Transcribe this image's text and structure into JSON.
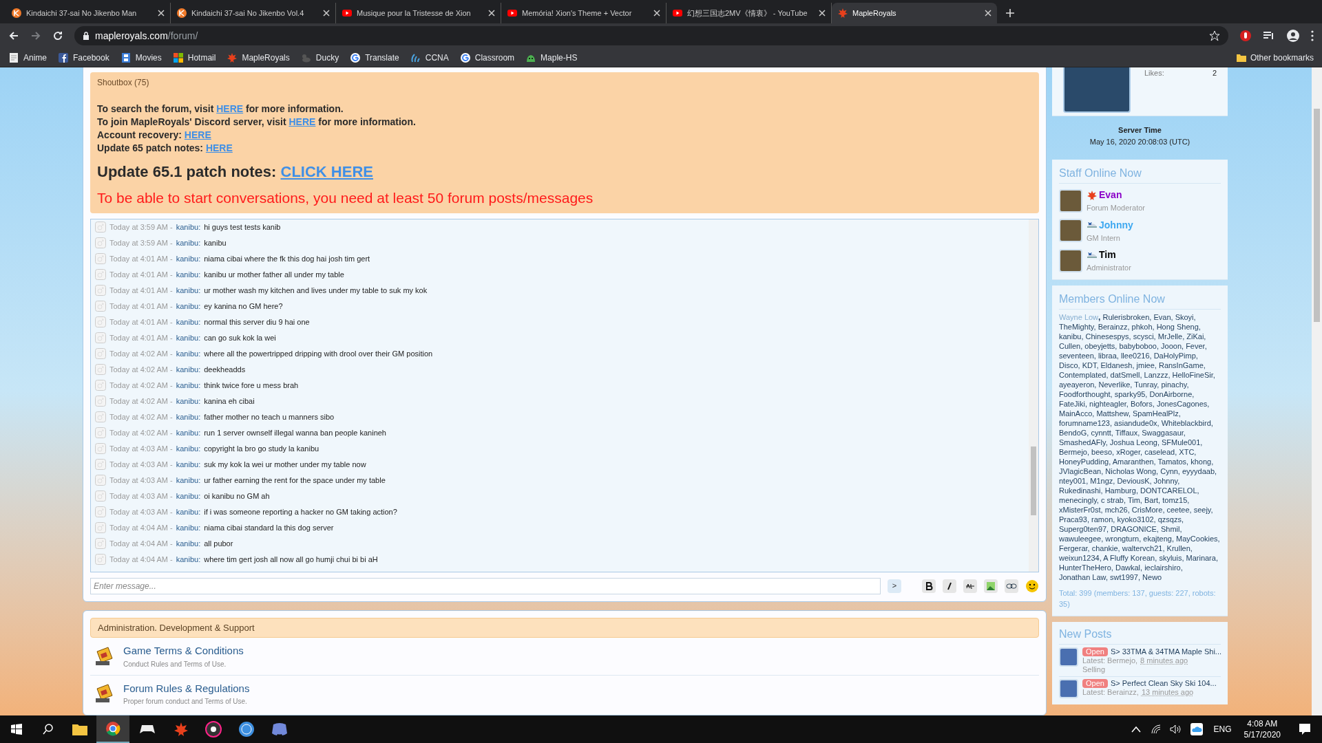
{
  "browser": {
    "tabs": [
      {
        "title": "Kindaichi 37-sai No Jikenbo Man",
        "kind": "k",
        "selected": false
      },
      {
        "title": "Kindaichi 37-sai No Jikenbo Vol.4",
        "kind": "k",
        "selected": false
      },
      {
        "title": "Musique pour la Tristesse de Xion",
        "kind": "yt",
        "selected": false
      },
      {
        "title": "Memória! Xion's Theme + Vector",
        "kind": "yt",
        "selected": false
      },
      {
        "title": "幻想三国志2MV《情衷》 - YouTube",
        "kind": "yt",
        "selected": false
      },
      {
        "title": "MapleRoyals",
        "kind": "leaf",
        "selected": true
      }
    ],
    "address_host": "mapleroyals.com",
    "address_path": "/forum/",
    "bookmarks": [
      {
        "label": "Anime",
        "kind": "page"
      },
      {
        "label": "Facebook",
        "kind": "fb"
      },
      {
        "label": "Movies",
        "kind": "film"
      },
      {
        "label": "Hotmail",
        "kind": "ms"
      },
      {
        "label": "MapleRoyals",
        "kind": "leaf"
      },
      {
        "label": "Ducky",
        "kind": "duck"
      },
      {
        "label": "Translate",
        "kind": "g"
      },
      {
        "label": "CCNA",
        "kind": "cisco"
      },
      {
        "label": "Classroom",
        "kind": "g"
      },
      {
        "label": "Maple-HS",
        "kind": "slime"
      }
    ],
    "other_bookmarks": "Other bookmarks"
  },
  "shoutbox": {
    "title": "Shoutbox (75)",
    "notices": [
      {
        "before": "To search the forum, visit ",
        "link": "HERE",
        "after": " for more information."
      },
      {
        "before": "To join MapleRoyals' Discord server, visit ",
        "link": "HERE",
        "after": " for more information."
      },
      {
        "before": "Account recovery: ",
        "link": "HERE"
      },
      {
        "before": "Update 65 patch notes: ",
        "link": "HERE"
      }
    ],
    "patch_label": "Update 65.1 patch notes: ",
    "patch_link": "CLICK HERE",
    "warning": "To be able to start conversations, you need at least 50 forum posts/messages",
    "messages": [
      {
        "time": "Today at 3:59 AM -",
        "user": "kanibu:",
        "text": "hi guys test tests kanib"
      },
      {
        "time": "Today at 3:59 AM -",
        "user": "kanibu:",
        "text": "kanibu"
      },
      {
        "time": "Today at 4:01 AM -",
        "user": "kanibu:",
        "text": "niama cibai where the fk this dog hai josh tim gert"
      },
      {
        "time": "Today at 4:01 AM -",
        "user": "kanibu:",
        "text": "kanibu ur mother father all under my table"
      },
      {
        "time": "Today at 4:01 AM -",
        "user": "kanibu:",
        "text": "ur mother wash my kitchen and lives under my table to suk my kok"
      },
      {
        "time": "Today at 4:01 AM -",
        "user": "kanibu:",
        "text": "ey kanina no GM here?"
      },
      {
        "time": "Today at 4:01 AM -",
        "user": "kanibu:",
        "text": "normal this server diu 9 hai one"
      },
      {
        "time": "Today at 4:01 AM -",
        "user": "kanibu:",
        "text": "can go suk kok la wei"
      },
      {
        "time": "Today at 4:02 AM -",
        "user": "kanibu:",
        "text": "where all the powertripped dripping with drool over their GM position"
      },
      {
        "time": "Today at 4:02 AM -",
        "user": "kanibu:",
        "text": "deekheadds"
      },
      {
        "time": "Today at 4:02 AM -",
        "user": "kanibu:",
        "text": "think twice fore u mess brah"
      },
      {
        "time": "Today at 4:02 AM -",
        "user": "kanibu:",
        "text": "kanina eh cibai"
      },
      {
        "time": "Today at 4:02 AM -",
        "user": "kanibu:",
        "text": "father mother no teach u manners sibo"
      },
      {
        "time": "Today at 4:02 AM -",
        "user": "kanibu:",
        "text": "run 1 server ownself illegal wanna ban people kanineh"
      },
      {
        "time": "Today at 4:03 AM -",
        "user": "kanibu:",
        "text": "copyright la bro go study la kanibu"
      },
      {
        "time": "Today at 4:03 AM -",
        "user": "kanibu:",
        "text": "suk my kok la wei ur mother under my table now"
      },
      {
        "time": "Today at 4:03 AM -",
        "user": "kanibu:",
        "text": "ur father earning the rent for the space under my table"
      },
      {
        "time": "Today at 4:03 AM -",
        "user": "kanibu:",
        "text": "oi kanibu no GM ah"
      },
      {
        "time": "Today at 4:03 AM -",
        "user": "kanibu:",
        "text": "if i was someone reporting a hacker no GM taking action?"
      },
      {
        "time": "Today at 4:04 AM -",
        "user": "kanibu:",
        "text": "niama cibai standard la this dog server"
      },
      {
        "time": "Today at 4:04 AM -",
        "user": "kanibu:",
        "text": "all pubor"
      },
      {
        "time": "Today at 4:04 AM -",
        "user": "kanibu:",
        "text": "where tim gert josh all now all go humji chui bi bi aH"
      }
    ],
    "input_placeholder": "Enter message...",
    "send": ">"
  },
  "forum": {
    "category": "Administration. Development & Support",
    "boards": [
      {
        "title": "Game Terms & Conditions",
        "description": "Conduct Rules and Terms of Use."
      },
      {
        "title": "Forum Rules & Regulations",
        "description": "Proper forum conduct and Terms of Use."
      }
    ]
  },
  "sidebar": {
    "likes_label": "Likes:",
    "likes": "2",
    "server_time_label": "Server Time",
    "server_time": "May 16, 2020 20:08:03 (UTC)",
    "staff_title": "Staff Online Now",
    "staff": [
      {
        "name": "Evan",
        "role": "Forum Moderator",
        "color": "#8a00c8",
        "kind": "leaf"
      },
      {
        "name": "Johnny",
        "role": "GM Intern",
        "color": "#3ea8f0",
        "kind": "w"
      },
      {
        "name": "Tim",
        "role": "Administrator",
        "color": "#000000",
        "kind": "w"
      }
    ],
    "members_title": "Members Online Now",
    "invisible_member": "Wayne Low",
    "invisible_member_comma": ",",
    "members": [
      "Rulerisbroken,",
      "Evan,",
      "Skoyi,",
      "TheMighty,",
      "Berainzz,",
      "phkoh,",
      "Hong Sheng,",
      "kanibu,",
      "Chinesespys,",
      "scysci,",
      "MrJelle,",
      "ZiKai,",
      "Cullen,",
      "obeyjetts,",
      "babyboboo,",
      "Jooon,",
      "Fever,",
      "seventeen,",
      "libraa,",
      "llee0216,",
      "DaHolyPimp,",
      "Disco,",
      "KDT,",
      "Eldanesh,",
      "jmiee,",
      "RansInGame,",
      "Contemplated,",
      "datSmell,",
      "Lanzzz,",
      "HelloFineSir,",
      "ayeayeron,",
      "Neverlike,",
      "Tunray,",
      "pinachy,",
      "Foodforthought,",
      "sparky95,",
      "DonAirborne,",
      "FateJiki,",
      "nighteagler,",
      "Bofors,",
      "JonesCagones,",
      "MainAcco,",
      "Mattshew,",
      "SpamHealPlz,",
      "forumname123,",
      "asiandude0x,",
      "Whiteblackbird,",
      "BendoG,",
      "cynntt,",
      "Tiffaux,",
      "Swaggasaur,",
      "SmashedAFly,",
      "Joshua Leong,",
      "SFMule001,",
      "Bermejo,",
      "beeso,",
      "xRoger,",
      "caselead,",
      "XTC,",
      "HoneyPudding,",
      "Amaranthen,",
      "Tamatos,",
      "khong,",
      "JVlagicBean,",
      "Nicholas Wong,",
      "Cynn,",
      "eyyydaab,",
      "ntey001,",
      "M1ngz,",
      "DeviousK,",
      "Johnny,",
      "Rukedinashi,",
      "Hamburg,",
      "DONTCARELOL,",
      "menecingly,",
      "c strab,",
      "Tim,",
      "Bart,",
      "tomz15,",
      "xMisterFr0st,",
      "mch26,",
      "CrisMore,",
      "ceetee,",
      "seejy,",
      "Praca93,",
      "ramon,",
      "kyoko3102,",
      "qzsqzs,",
      "Superg0ten97,",
      "DRAGONICE,",
      "Shmil,",
      "wawuleegee,",
      "wrongturn,",
      "ekajteng,",
      "MayCookies,",
      "Fergerar,",
      "chankie,",
      "waltervch21,",
      "Krullen,",
      "weixun1234,",
      "A Fluffy Korean,",
      "skyluis,",
      "Marinara,",
      "HunterTheHero,",
      "Dawkal,",
      "ieclairshiro,",
      "Jonathan Law,",
      "swt1997,",
      "Newo"
    ],
    "members_total": "Total: 399 (members: 137, guests: 227, robots: 35)",
    "new_posts_title": "New Posts",
    "posts": [
      {
        "prefix": "Open",
        "title": "S> 33TMA & 34TMA Maple Shi...",
        "latest": "Latest: Bermejo,",
        "ago": "8 minutes ago",
        "forum": "Selling"
      },
      {
        "prefix": "Open",
        "title": "S> Perfect Clean Sky Ski 104...",
        "latest": "Latest: Berainzz,",
        "ago": "13 minutes ago"
      }
    ]
  },
  "taskbar": {
    "language": "ENG",
    "time": "4:08 AM",
    "date": "5/17/2020"
  }
}
